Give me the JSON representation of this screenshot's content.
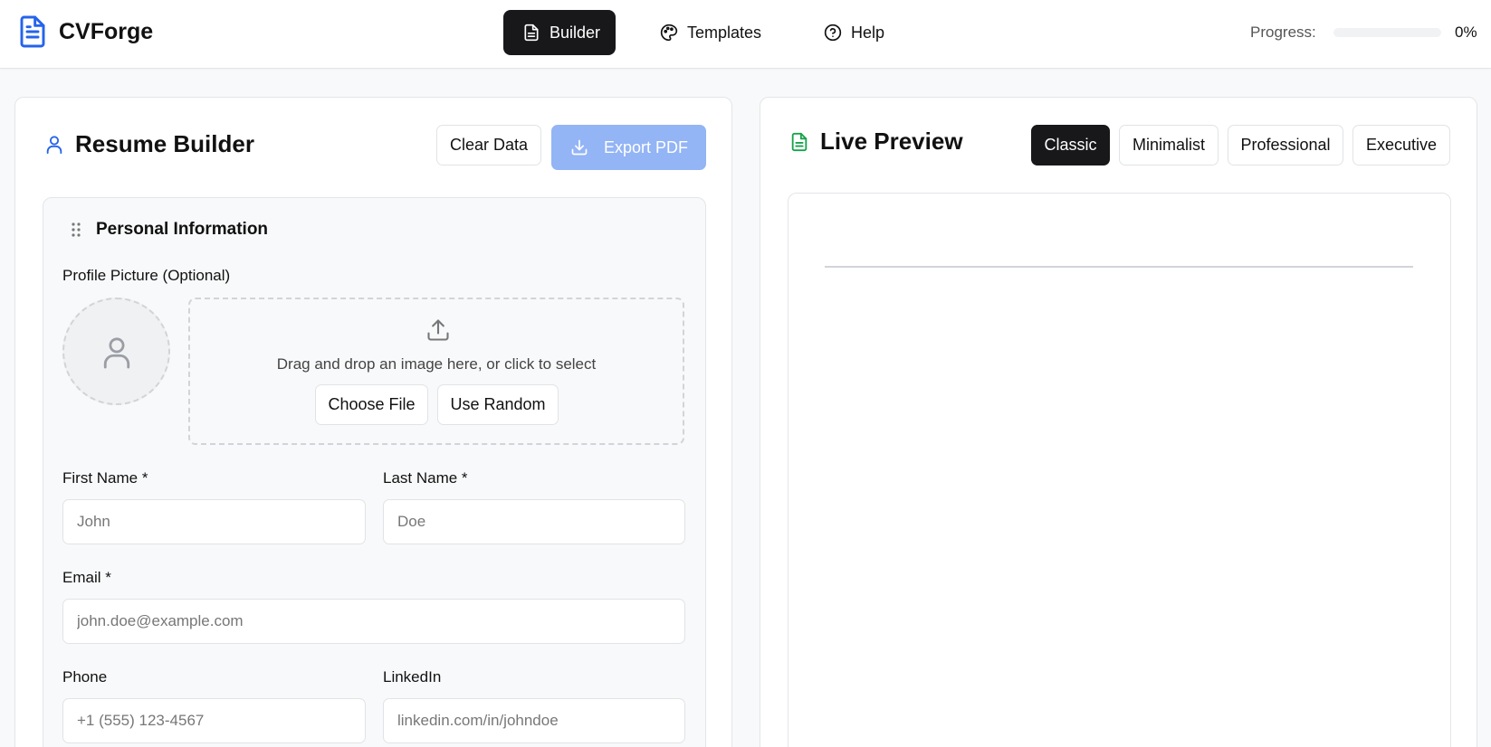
{
  "header": {
    "app_name": "CVForge",
    "nav": [
      {
        "label": "Builder",
        "icon": "document-icon",
        "active": true
      },
      {
        "label": "Templates",
        "icon": "palette-icon",
        "active": false
      },
      {
        "label": "Help",
        "icon": "help-circle-icon",
        "active": false
      }
    ],
    "progress_label": "Progress:",
    "progress_value": 0,
    "progress_text": "0%"
  },
  "builder": {
    "title": "Resume Builder",
    "clear_label": "Clear Data",
    "export_label": "Export PDF",
    "section": {
      "title": "Personal Information",
      "profile_label": "Profile Picture (Optional)",
      "dropzone_text": "Drag and drop an image here, or click to select",
      "choose_file_label": "Choose File",
      "use_random_label": "Use Random",
      "fields": {
        "first_name": {
          "label": "First Name *",
          "placeholder": "John",
          "value": ""
        },
        "last_name": {
          "label": "Last Name *",
          "placeholder": "Doe",
          "value": ""
        },
        "email": {
          "label": "Email *",
          "placeholder": "john.doe@example.com",
          "value": ""
        },
        "phone": {
          "label": "Phone",
          "placeholder": "+1 (555) 123-4567",
          "value": ""
        },
        "linkedin": {
          "label": "LinkedIn",
          "placeholder": "linkedin.com/in/johndoe",
          "value": ""
        }
      }
    }
  },
  "preview": {
    "title": "Live Preview",
    "templates": [
      "Classic",
      "Minimalist",
      "Professional",
      "Executive"
    ],
    "active_template": "Classic"
  },
  "colors": {
    "brand": "#2563eb",
    "preview_icon": "#16a34a",
    "dark": "#18181b",
    "export_disabled": "#93b4f5"
  }
}
